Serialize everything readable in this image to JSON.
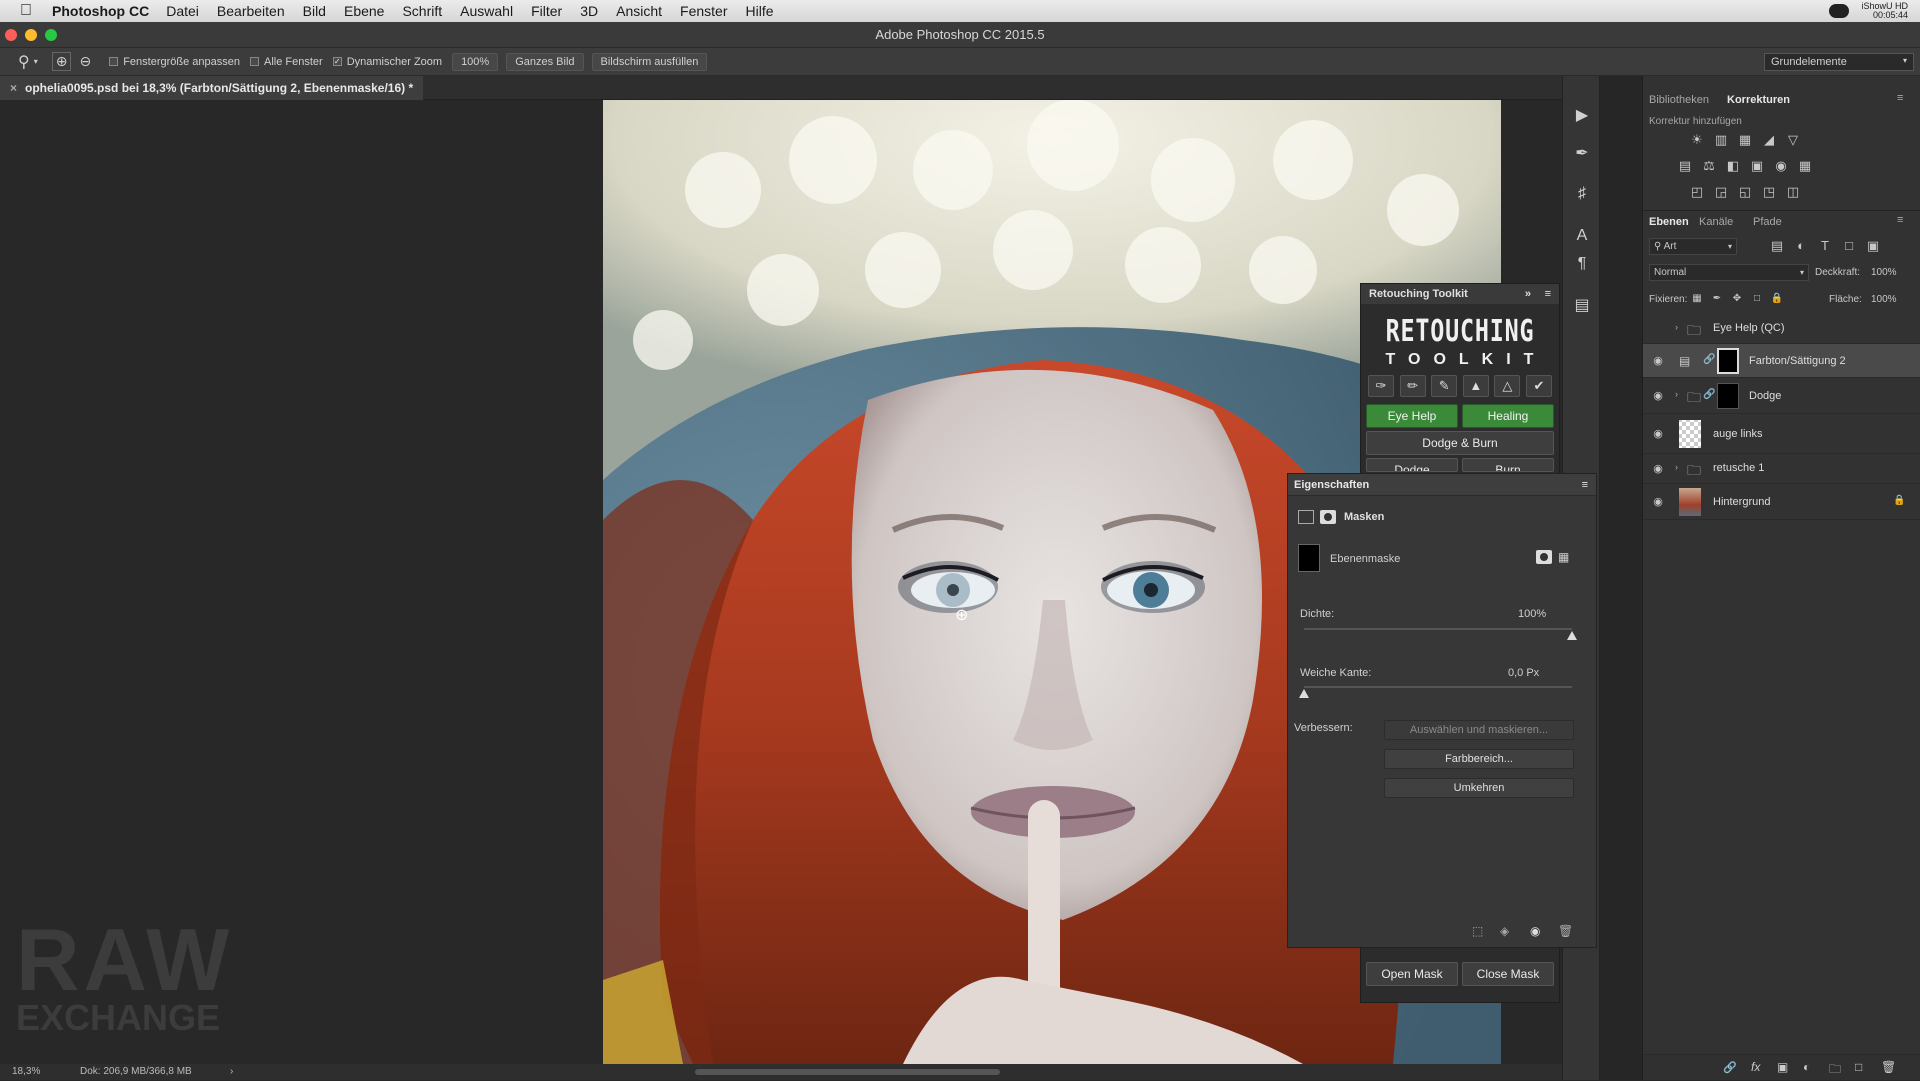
{
  "menubar": {
    "app": "Photoshop CC",
    "items": [
      "Datei",
      "Bearbeiten",
      "Bild",
      "Ebene",
      "Schrift",
      "Auswahl",
      "Filter",
      "3D",
      "Ansicht",
      "Fenster",
      "Hilfe"
    ],
    "recorder_line1": "iShowU HD",
    "recorder_line2": "00:05:44"
  },
  "window": {
    "title": "Adobe Photoshop CC 2015.5"
  },
  "options": {
    "fit_window": "Fenstergröße anpassen",
    "all_windows": "Alle Fenster",
    "scrubby_zoom": "Dynamischer Zoom",
    "zoom_value": "100%",
    "fit_screen": "Ganzes Bild",
    "fill_screen": "Bildschirm ausfüllen",
    "workspace": "Grundelemente"
  },
  "document": {
    "tab_title": "ophelia0095.psd bei 18,3% (Farbton/Sättigung 2, Ebenenmaske/16) *"
  },
  "status": {
    "zoom": "18,3%",
    "doc": "Dok: 206,9 MB/366,8 MB"
  },
  "watermark": {
    "line1": "RAW",
    "line2": "EXCHANGE"
  },
  "retouching_toolkit": {
    "header": "Retouching Toolkit",
    "logo_line1": "RETOUCHING",
    "logo_line2": "TOOLKIT",
    "eye_help": "Eye Help",
    "healing": "Healing",
    "dodge_burn": "Dodge & Burn",
    "dodge": "Dodge",
    "burn": "Burn",
    "open_mask": "Open Mask",
    "close_mask": "Close Mask"
  },
  "properties": {
    "header": "Eigenschaften",
    "masks_label": "Masken",
    "layer_mask": "Ebenenmaske",
    "density_label": "Dichte:",
    "density_value": "100%",
    "density": 1.0,
    "feather_label": "Weiche Kante:",
    "feather_value": "0,0 Px",
    "feather": 0.0,
    "refine_label": "Verbessern:",
    "select_mask": "Auswählen und maskieren...",
    "color_range": "Farbbereich...",
    "invert": "Umkehren"
  },
  "panels": {
    "tab_libraries": "Bibliotheken",
    "tab_adjustments": "Korrekturen",
    "add_adjustment": "Korrektur hinzufügen",
    "tab_layers": "Ebenen",
    "tab_channels": "Kanäle",
    "tab_paths": "Pfade",
    "filter_kind": "Art",
    "blend_mode": "Normal",
    "opacity_label": "Deckkraft:",
    "opacity_value": "100%",
    "lock_label": "Fixieren:",
    "fill_label": "Fläche:",
    "fill_value": "100%"
  },
  "layers": [
    {
      "name": "Eye Help (QC)",
      "type": "group",
      "visible": false
    },
    {
      "name": "Farbton/Sättigung 2",
      "type": "adjustment",
      "visible": true,
      "selected": true
    },
    {
      "name": "Dodge",
      "type": "group",
      "visible": true
    },
    {
      "name": "auge links",
      "type": "pixel",
      "visible": true
    },
    {
      "name": "retusche 1",
      "type": "group",
      "visible": true
    },
    {
      "name": "Hintergrund",
      "type": "background",
      "visible": true
    }
  ],
  "colors": {
    "accent_green": "#3a8a3a",
    "panel_bg": "#323232",
    "selection": "#4a4a4a"
  }
}
